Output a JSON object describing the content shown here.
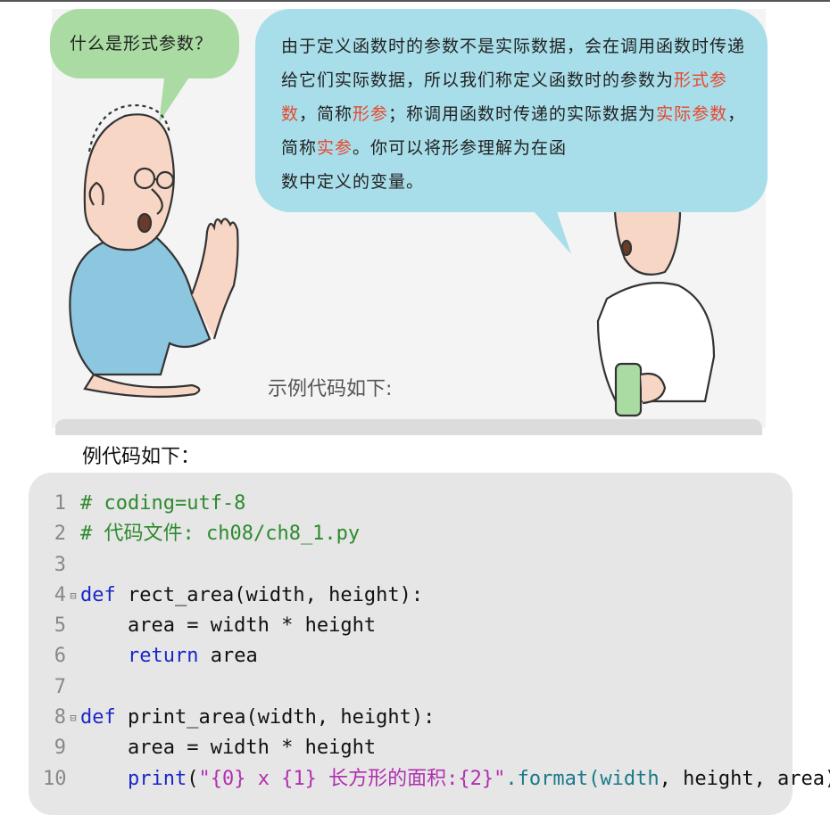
{
  "comic": {
    "question": "什么是形式参数？",
    "answer": {
      "line1": "由于定义函数时的参数不是实际数据，会在调用函数时传递",
      "line2_pre": "给它们实际数据，所以我们称定义函数时的参数为",
      "line2_hl": "形式参",
      "line3_hl1": "数",
      "line3_mid1": "，简称",
      "line3_hl2": "形参",
      "line3_mid2": "；称调用函数时传递的实际数据为",
      "line3_hl3": "实际参数",
      "line3_end": "，",
      "line4_pre": "简称",
      "line4_hl": "实参",
      "line4_post": "。你可以将形参理解为在函",
      "line5": "数中定义的变量。"
    },
    "example_label_inline": "示例代码如下:"
  },
  "example_label": "例代码如下：",
  "code": {
    "lines": [
      {
        "n": "1",
        "comment": "# coding=utf-8"
      },
      {
        "n": "2",
        "comment": "# 代码文件: ch08/ch8_1.py"
      },
      {
        "n": "3"
      },
      {
        "n": "4",
        "kw": "def",
        "rest": " rect_area(width, height):"
      },
      {
        "n": "5",
        "rest": "    area = width * height"
      },
      {
        "n": "6",
        "kw": "return",
        "rest": " area"
      },
      {
        "n": "7"
      },
      {
        "n": "8",
        "kw": "def",
        "rest": " print_area(width, height):"
      },
      {
        "n": "9",
        "rest": "    area = width * height"
      },
      {
        "n": "10",
        "kw": "print",
        "p1": "(",
        "str": "\"{0} x {1} 长方形的面积:{2}\"",
        "fmt": ".format(",
        "w": "width",
        "rest2": ", height, area))"
      }
    ]
  },
  "colors": {
    "bubble_small": "#a9dba2",
    "bubble_big": "#a8deea",
    "highlight": "#e8472c",
    "code_bg": "#e6e6e6",
    "comment": "#2d8a2d",
    "keyword": "#1a27c8",
    "string": "#b12fb0"
  }
}
